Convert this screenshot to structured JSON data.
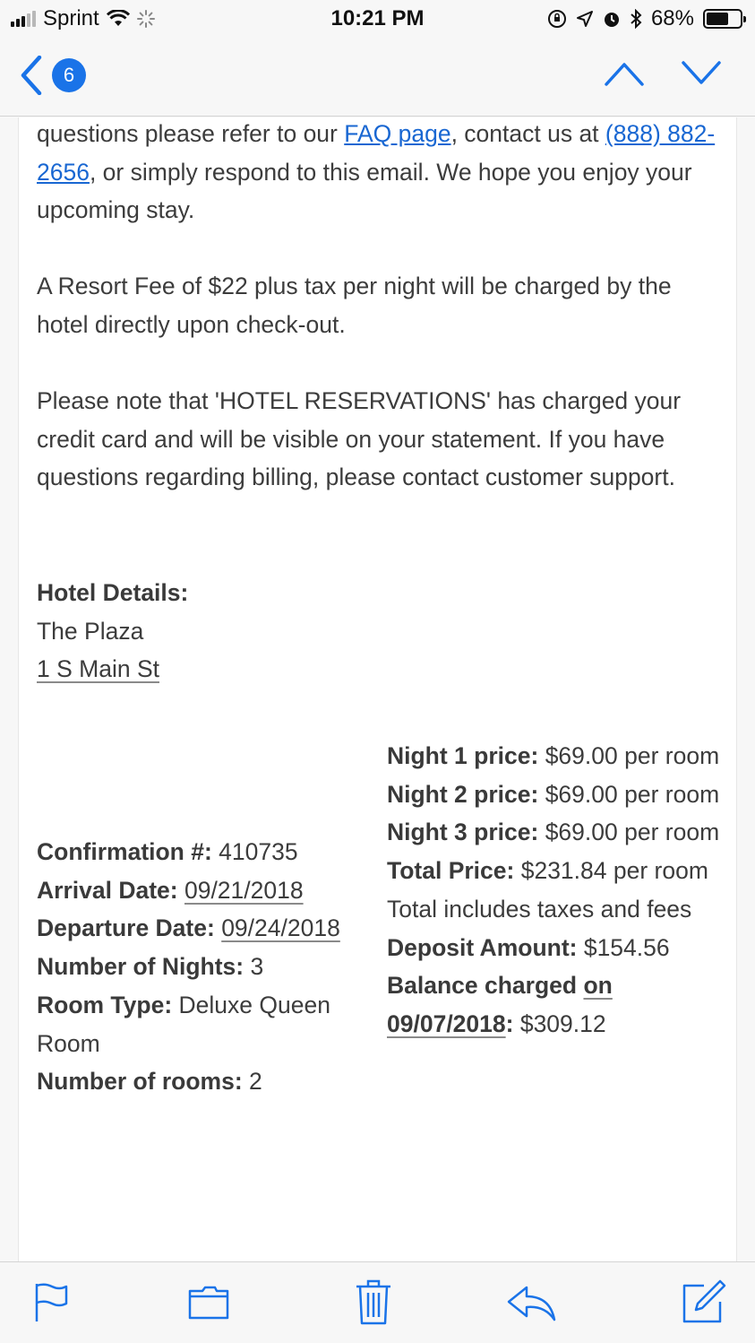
{
  "status": {
    "carrier": "Sprint",
    "time": "10:21 PM",
    "battery_percent": "68%",
    "battery_level": 0.68
  },
  "nav": {
    "unread_count": "6"
  },
  "body": {
    "p1_a": "questions please refer to our ",
    "faq_link": "FAQ page",
    "p1_b": ", contact us at ",
    "phone_link": "(888) 882-2656",
    "p1_c": ", or simply respond to this email. We hope you enjoy your upcoming stay.",
    "p2": "A Resort Fee of $22 plus tax per night will be charged by the hotel directly upon check-out.",
    "p3": "Please note that 'HOTEL RESERVATIONS' has charged your credit card and will be visible on your statement. If you have questions regarding billing, please contact customer support."
  },
  "hotel": {
    "heading": "Hotel Details:",
    "name": "The Plaza",
    "address": "1 S Main St"
  },
  "booking": {
    "confirmation_label": "Confirmation #:",
    "confirmation_value": " 410735",
    "arrival_label": "Arrival Date:",
    "arrival_value": "09/21/2018",
    "departure_label": "Departure Date:",
    "departure_value": "09/24/2018",
    "nights_label": "Number of Nights:",
    "nights_value": " 3",
    "room_type_label": "Room Type:",
    "room_type_value": " Deluxe Queen Room",
    "rooms_label": "Number of rooms:",
    "rooms_value": " 2"
  },
  "pricing": {
    "night1_label": "Night 1 price:",
    "night1_value": " $69.00 per room",
    "night2_label": "Night 2 price:",
    "night2_value": " $69.00 per room",
    "night3_label": "Night 3 price:",
    "night3_value": " $69.00 per room",
    "total_label": "Total Price:",
    "total_value": " $231.84 per room",
    "total_note": "Total includes taxes and fees",
    "deposit_label": "Deposit Amount:",
    "deposit_value": " $154.56",
    "balance_label_a": "Balance charged ",
    "balance_label_on": "on",
    "balance_date": "09/07/2018",
    "balance_colon": ":",
    "balance_value": " $309.12"
  },
  "toolbar": {
    "icons": [
      "flag-icon",
      "folder-icon",
      "trash-icon",
      "reply-icon",
      "compose-icon"
    ]
  },
  "colors": {
    "accent": "#1a73e8",
    "link": "#1967d2",
    "text": "#3c3c3c"
  }
}
